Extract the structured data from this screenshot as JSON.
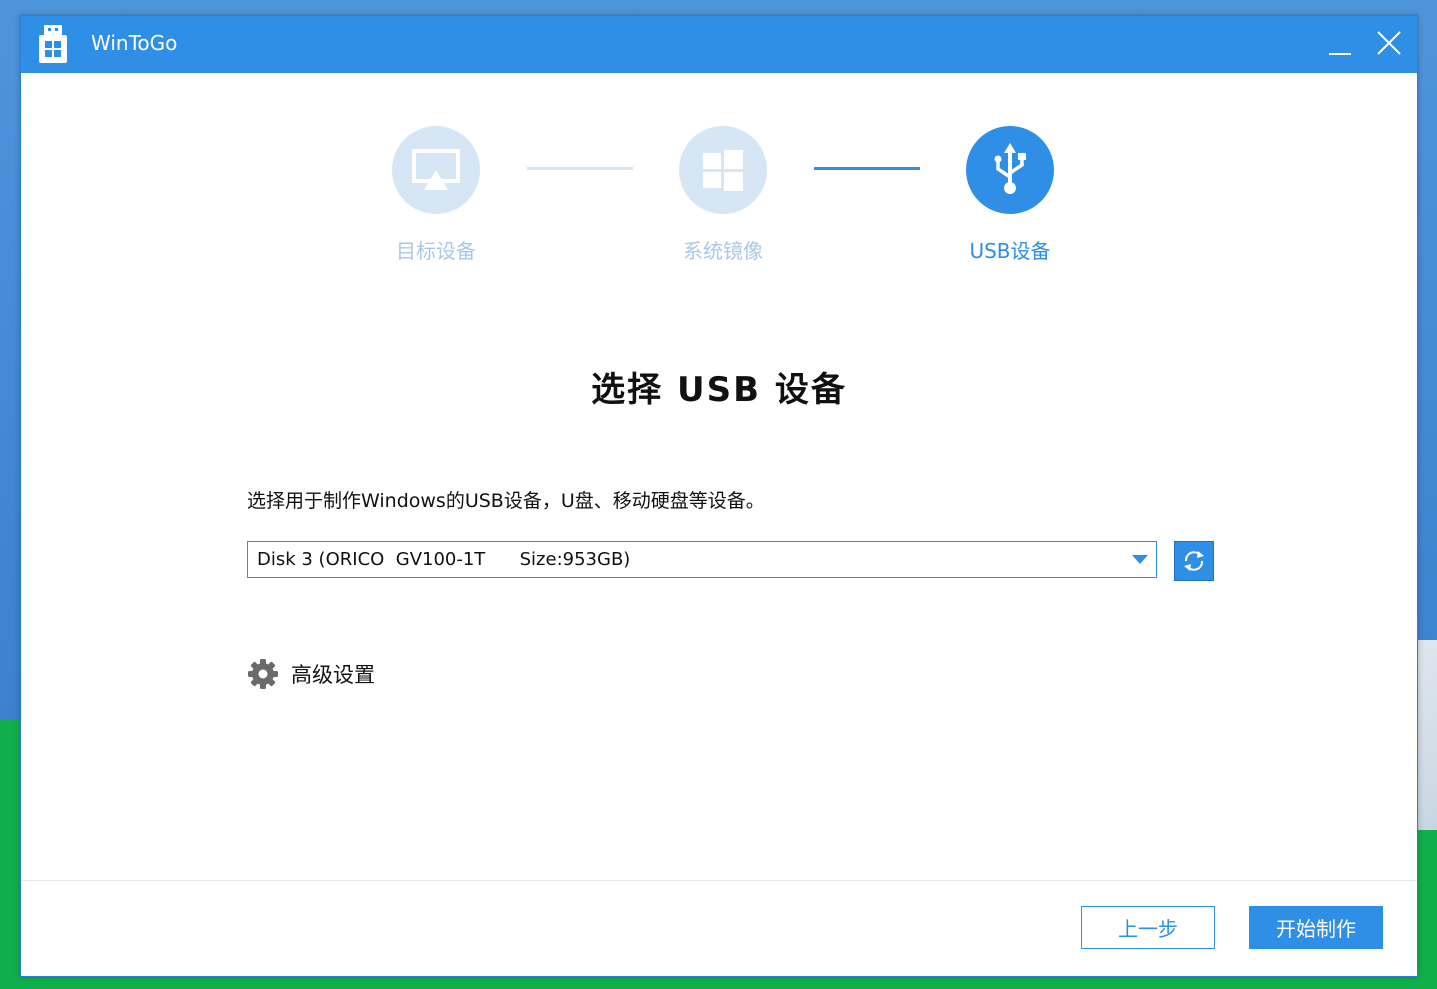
{
  "window": {
    "title": "WinToGo"
  },
  "colors": {
    "accent": "#2f8ee5",
    "step_inactive": "#d6e6f5",
    "step_label_inactive": "#a9c8e8"
  },
  "steps": [
    {
      "label": "目标设备",
      "icon": "monitor-icon",
      "state": "completed"
    },
    {
      "label": "系统镜像",
      "icon": "windows-logo-icon",
      "state": "completed"
    },
    {
      "label": "USB设备",
      "icon": "usb-icon",
      "state": "active"
    }
  ],
  "main": {
    "heading": "选择 USB 设备",
    "description": "选择用于制作Windows的USB设备，U盘、移动硬盘等设备。",
    "device_select": {
      "value": "Disk 3 (ORICO  GV100-1T      Size:953GB)"
    },
    "advanced_label": "高级设置"
  },
  "footer": {
    "prev_label": "上一步",
    "start_label": "开始制作"
  }
}
